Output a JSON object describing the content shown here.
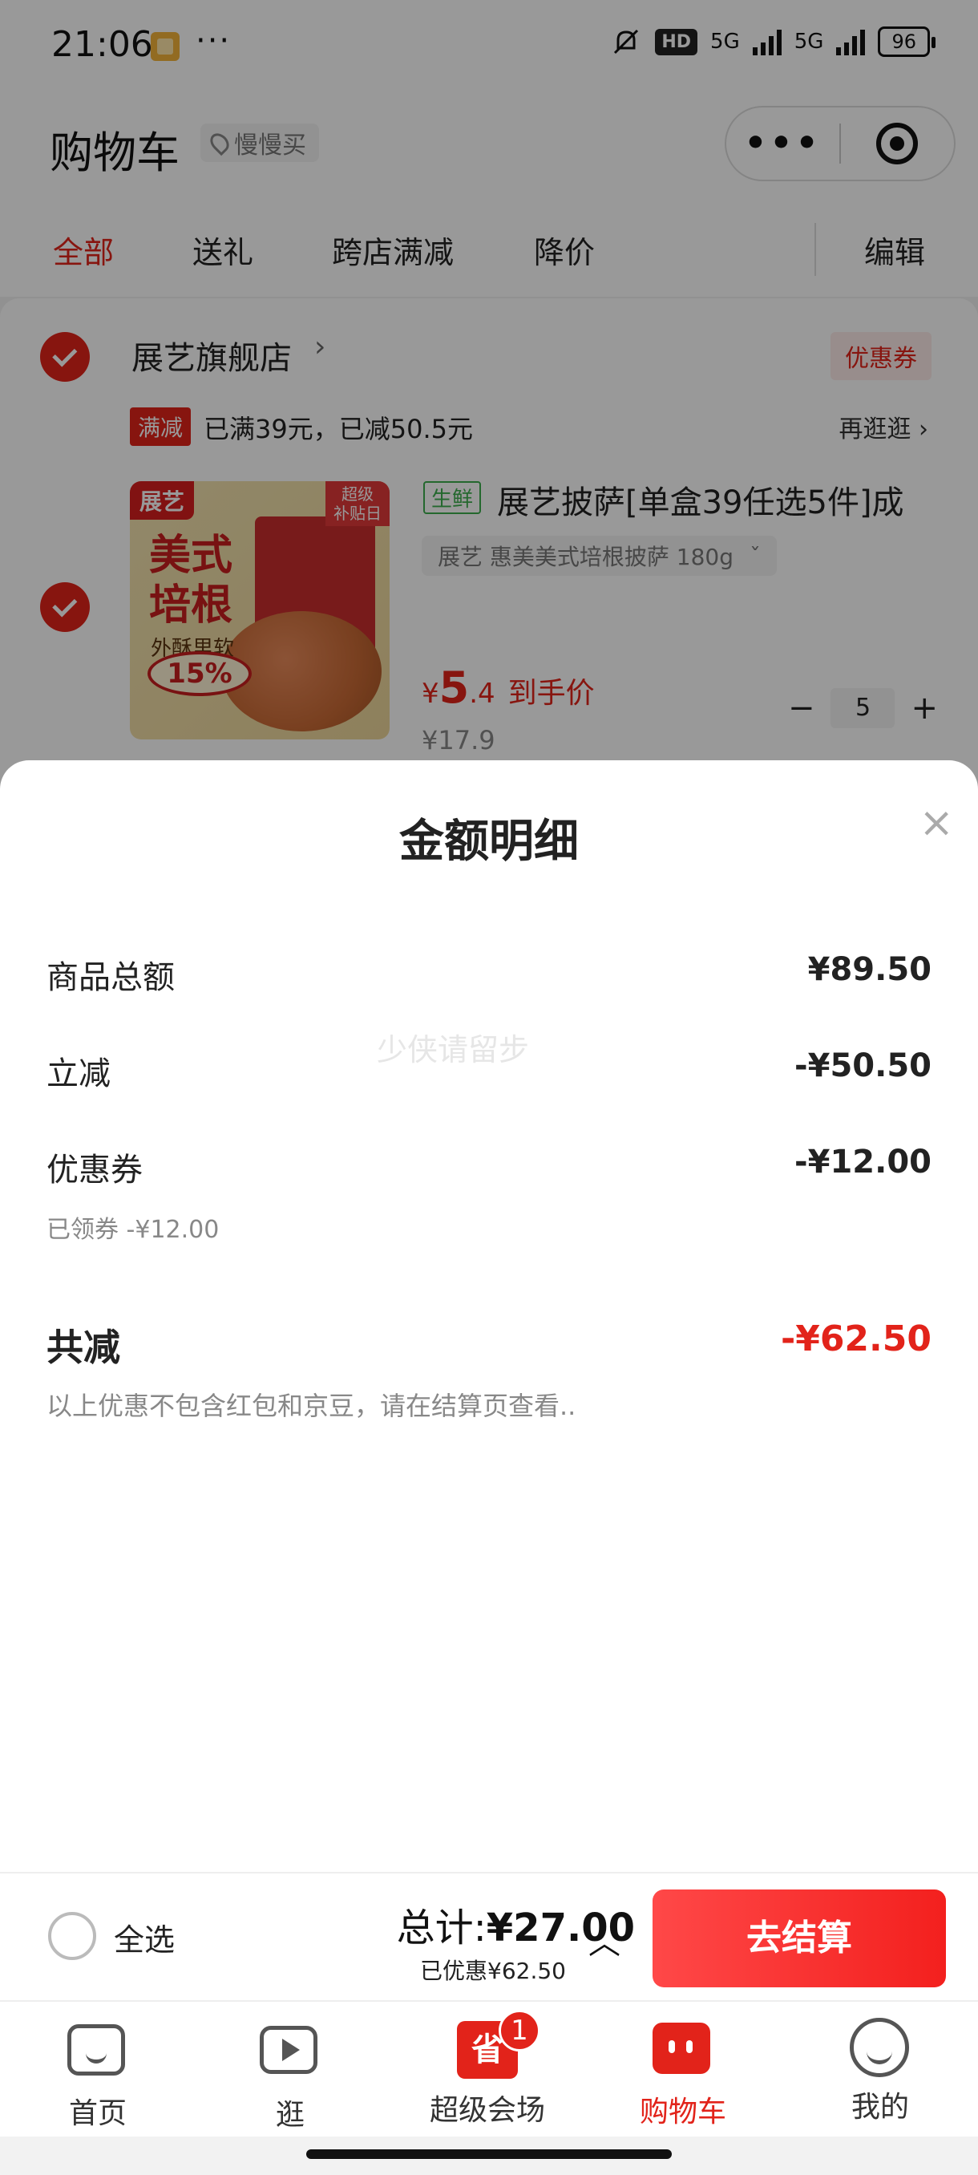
{
  "status_bar": {
    "time": "21:06",
    "dots": "···",
    "hd": "HD",
    "net1": "5G",
    "net2": "5G",
    "battery": "96"
  },
  "header": {
    "title": "购物车",
    "location": "慢慢买",
    "capsule_more": "•••"
  },
  "tabs": {
    "items": [
      "全部",
      "送礼",
      "跨店满减",
      "降价"
    ],
    "edit": "编辑"
  },
  "store": {
    "name": "展艺旗舰店",
    "arrow": "›",
    "coupon": "优惠券",
    "promo_tag": "满减",
    "promo_text": "已满39元，已减50.5元",
    "promo_more": "再逛逛 ›",
    "product": {
      "image_brand": "展艺",
      "image_title": "美式\n培根",
      "image_sub": "外酥里软",
      "image_badge": "超级\n补贴日",
      "image_pct": "15%",
      "fresh_tag": "生鲜",
      "name": "展艺披萨[单盒39任选5件]成",
      "variant": "展艺 惠美美式培根披萨 180g",
      "price_currency": "¥",
      "price_int": "5",
      "price_dec": ".4",
      "price_label": "到手价",
      "orig_price": "¥17.9",
      "minus": "−",
      "qty": "5",
      "plus": "+"
    }
  },
  "sheet": {
    "title": "金额明细",
    "close": "×",
    "watermark": "少侠请留步",
    "rows": [
      {
        "label": "商品总额",
        "value": "¥89.50"
      },
      {
        "label": "立减",
        "value": "-¥50.50"
      },
      {
        "label": "优惠券",
        "value": "-¥12.00",
        "note": "已领券 -¥12.00"
      }
    ],
    "total_label": "共减",
    "total_value": "-¥62.50",
    "total_note": "以上优惠不包含红包和京豆，请在结算页查看.."
  },
  "checkout": {
    "select_all": "全选",
    "total_prefix": "总计:",
    "total_amount": "¥27.00",
    "saved": "已优惠¥62.50",
    "chevron": "︿",
    "button": "去结算"
  },
  "nav": {
    "items": [
      {
        "label": "首页",
        "icon": "home-icon"
      },
      {
        "label": "逛",
        "icon": "video-icon"
      },
      {
        "label": "超级会场",
        "icon": "gift-icon",
        "badge": "1",
        "glyph": "省"
      },
      {
        "label": "购物车",
        "icon": "cart-icon",
        "active": true
      },
      {
        "label": "我的",
        "icon": "profile-icon"
      }
    ]
  },
  "colors": {
    "accent": "#e2231a",
    "fresh": "#3cae4e"
  }
}
